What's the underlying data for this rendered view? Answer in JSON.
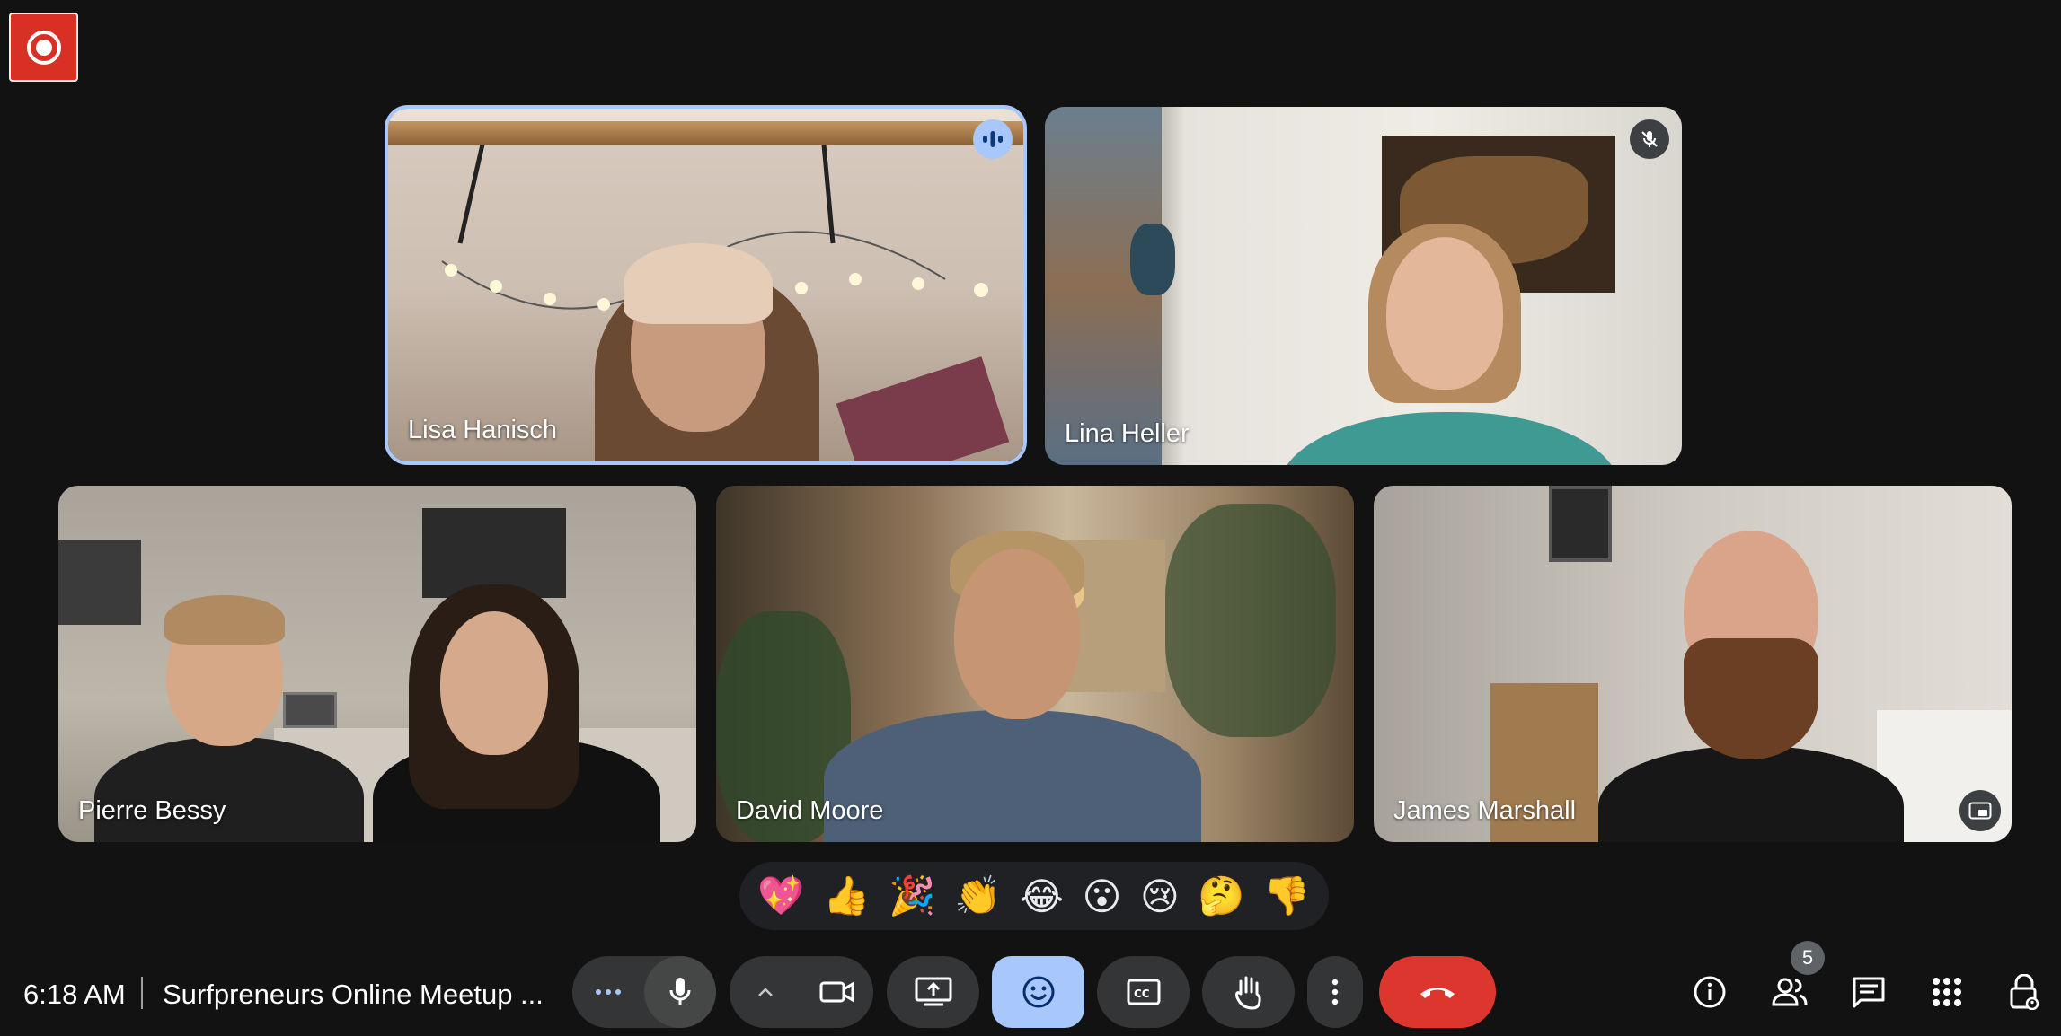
{
  "meeting": {
    "time": "6:18 AM",
    "title": "Surfpreneurs Online Meetup ...",
    "participant_count": "5"
  },
  "tiles": [
    {
      "name": "Lisa Hanisch",
      "speaking": true
    },
    {
      "name": "Lina Heller",
      "muted": true
    },
    {
      "name": "Pierre Bessy"
    },
    {
      "name": "David Moore"
    },
    {
      "name": "James Marshall"
    }
  ],
  "reactions": [
    "💖",
    "👍",
    "🎉",
    "👏",
    "😂",
    "😮",
    "😢",
    "🤔",
    "👎"
  ],
  "controls": {
    "left": [
      "more-options-icon",
      "microphone-icon",
      "chevron-up-icon",
      "camera-icon",
      "present-screen-icon",
      "emoji-icon",
      "captions-icon",
      "raise-hand-icon",
      "kebab-menu-icon",
      "end-call-icon"
    ],
    "right": [
      "info-icon",
      "people-icon",
      "chat-icon",
      "apps-icon",
      "host-controls-icon"
    ]
  },
  "colors": {
    "background": "#121212",
    "active_tile_outline": "#a8c7fa",
    "end_call": "#dc362e",
    "record": "#d93025",
    "control_bg": "#333537"
  }
}
